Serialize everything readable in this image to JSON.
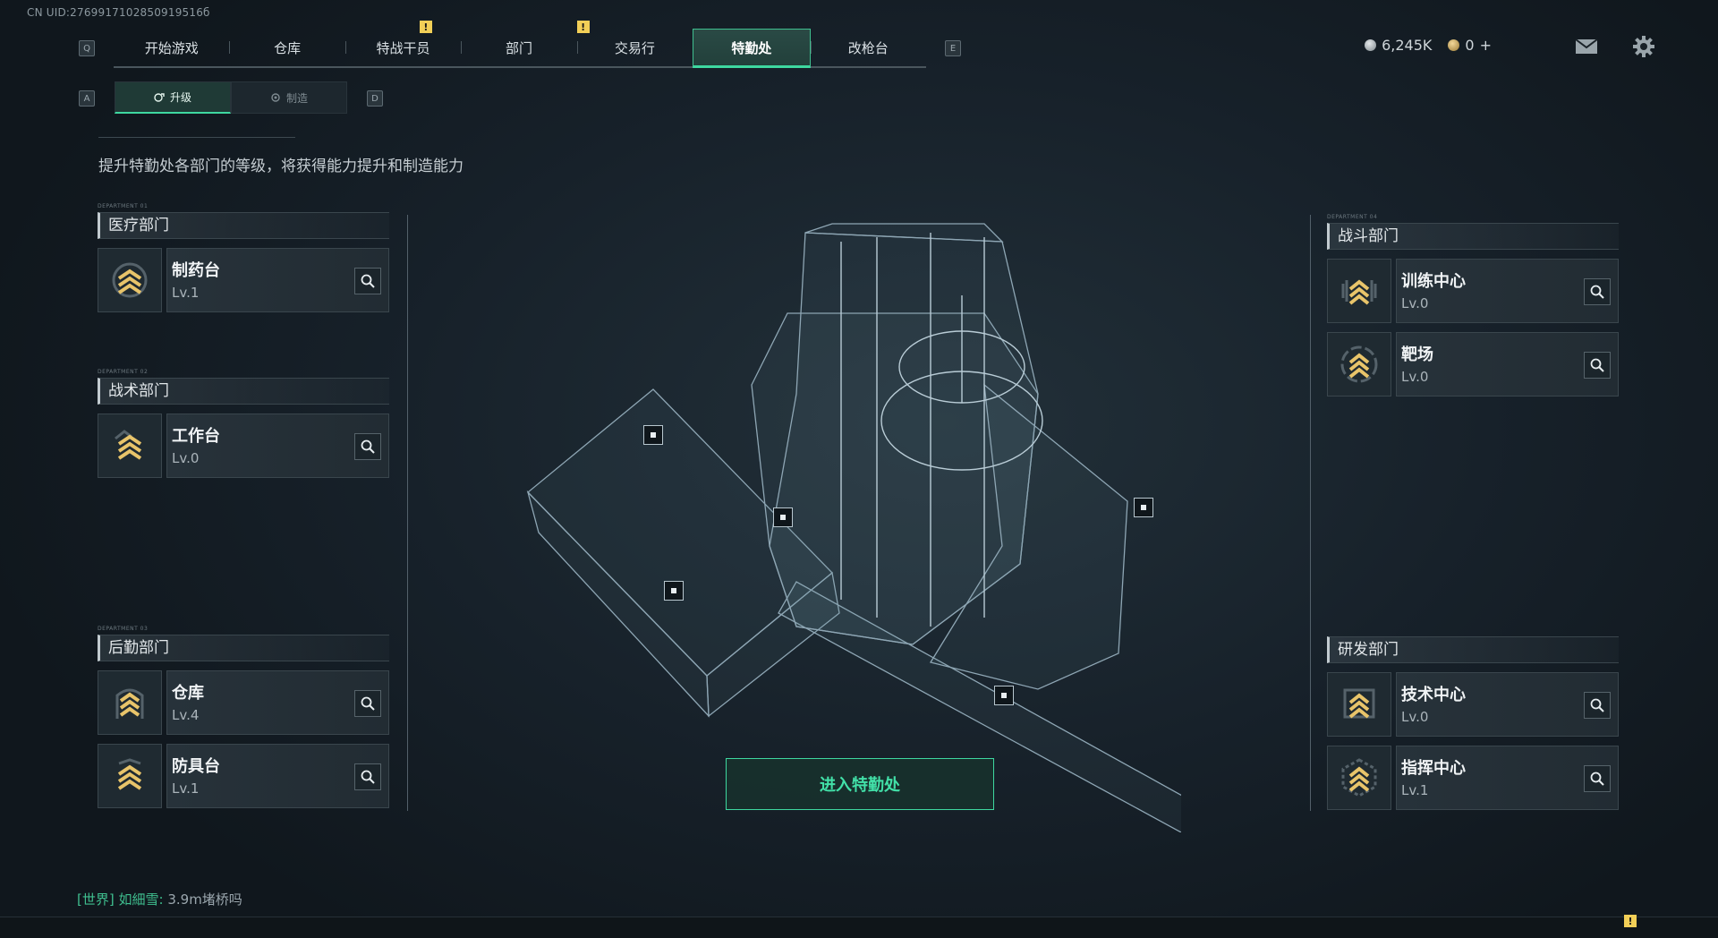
{
  "uid": "CN UID:2769917102850919516б",
  "nav": {
    "left_key": "Q",
    "right_key": "E",
    "tabs": [
      {
        "label": "开始游戏",
        "alert": false
      },
      {
        "label": "仓库",
        "alert": false
      },
      {
        "label": "特战干员",
        "alert": true
      },
      {
        "label": "部门",
        "alert": false
      },
      {
        "label": "交易行",
        "alert": true
      },
      {
        "label": "特勤处",
        "alert": false,
        "active": true
      },
      {
        "label": "改枪台",
        "alert": false
      }
    ],
    "alert_mark": "!"
  },
  "currency": {
    "silver": "6,245K",
    "gold": "0",
    "gold_add": "+"
  },
  "subnav": {
    "left_key": "A",
    "right_key": "D",
    "upgrade_label": "升级",
    "craft_label": "制造"
  },
  "description": "提升特勤处各部门的等级，将获得能力提升和制造能力",
  "departments": {
    "medical": {
      "tag": "DEPARTMENT 01",
      "title": "医疗部门",
      "facilities": [
        {
          "name": "制药台",
          "level": "Lv.1"
        }
      ]
    },
    "tactical": {
      "tag": "DEPARTMENT 02",
      "title": "战术部门",
      "facilities": [
        {
          "name": "工作台",
          "level": "Lv.0"
        }
      ]
    },
    "logistics": {
      "tag": "DEPARTMENT 03",
      "title": "后勤部门",
      "facilities": [
        {
          "name": "仓库",
          "level": "Lv.4"
        },
        {
          "name": "防具台",
          "level": "Lv.1"
        }
      ]
    },
    "combat": {
      "tag": "DEPARTMENT 04",
      "title": "战斗部门",
      "facilities": [
        {
          "name": "训练中心",
          "level": "Lv.0"
        },
        {
          "name": "靶场",
          "level": "Lv.0"
        }
      ]
    },
    "research": {
      "tag": "",
      "title": "研发部门",
      "facilities": [
        {
          "name": "技术中心",
          "level": "Lv.0"
        },
        {
          "name": "指挥中心",
          "level": "Lv.1"
        }
      ]
    }
  },
  "enter_button": "进入特勤处",
  "chat": {
    "channel": "[世界]",
    "speaker": "如細雪:",
    "message": "3.9m堵桥吗"
  },
  "colors": {
    "accent": "#3ed8a0",
    "alert": "#f2cf57",
    "chevron": "#e8c46a"
  },
  "icons": [
    "envelope-icon",
    "gear-icon",
    "search-icon",
    "upgrade-chevron-icon"
  ]
}
